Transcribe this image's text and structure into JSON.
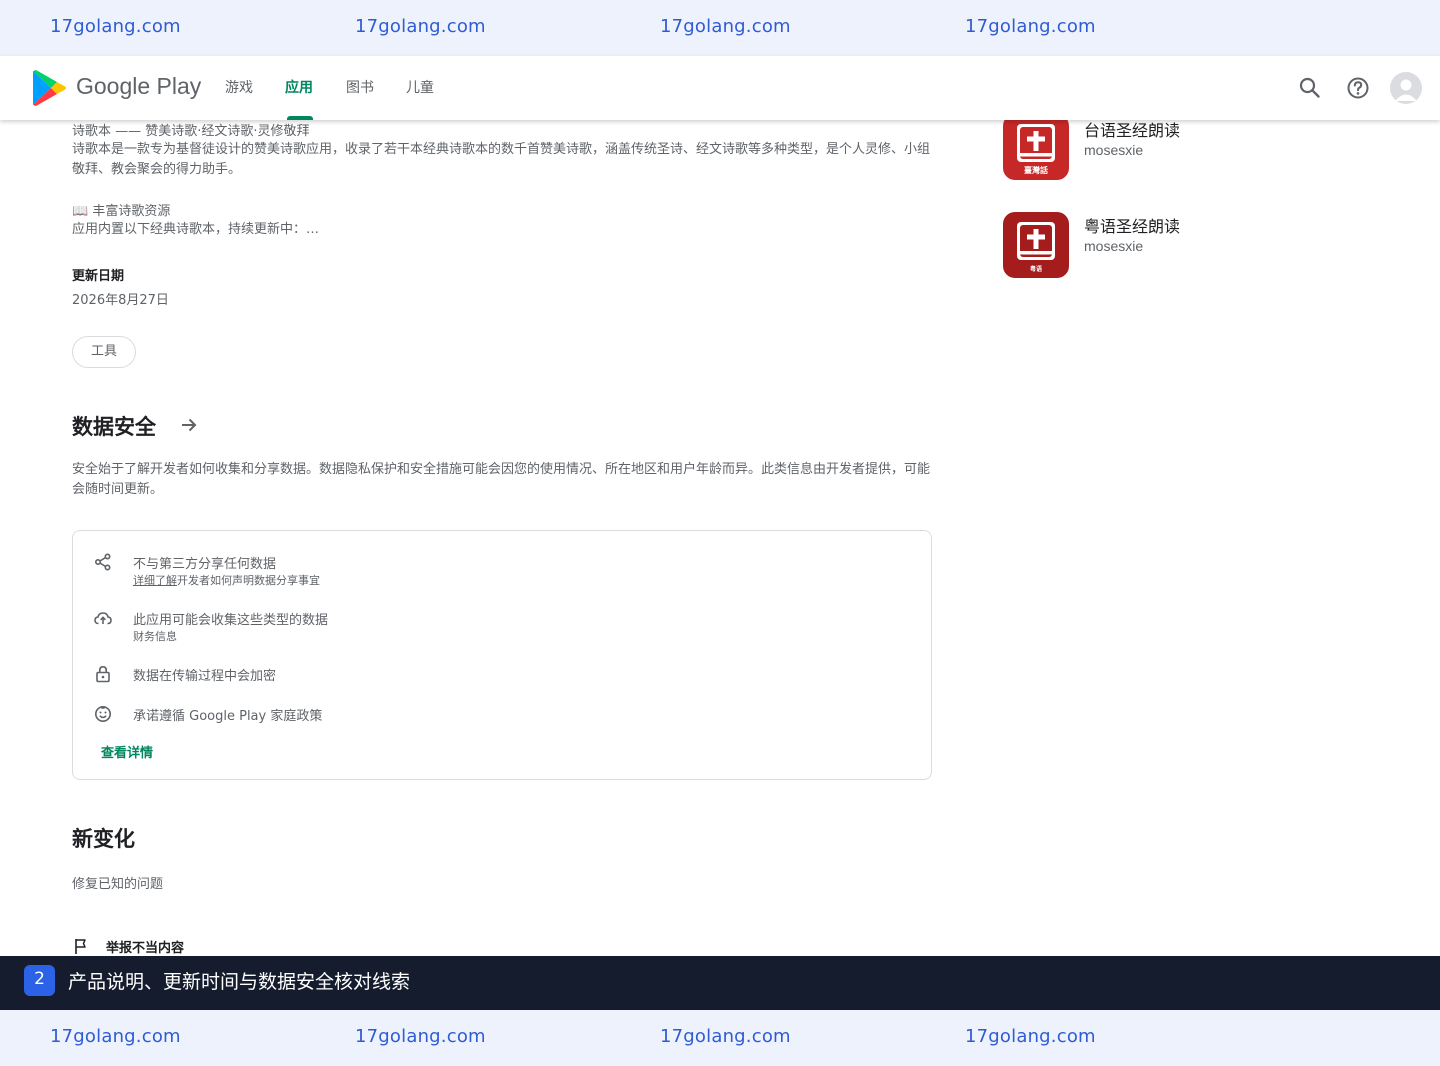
{
  "watermark": {
    "top": [
      "17golang.com",
      "17golang.com",
      "17golang.com",
      "17golang.com"
    ],
    "bottom": [
      "17golang.com",
      "17golang.com",
      "17golang.com",
      "17golang.com"
    ]
  },
  "header": {
    "brand": "Google Play",
    "nav": [
      "游戏",
      "应用",
      "图书",
      "儿童"
    ],
    "active_nav": "应用",
    "icons": [
      "search-icon",
      "help-icon",
      "account-icon"
    ]
  },
  "about": {
    "title_line": "诗歌本 —— 赞美诗歌·经文诗歌·灵修敬拜",
    "body": "诗歌本是一款专为基督徒设计的赞美诗歌应用，收录了若干本经典诗歌本的数千首赞美诗歌，涵盖传统圣诗、经文诗歌等多种类型，是个人灵修、小组敬拜、教会聚会的得力助手。",
    "resource_title": "📖 丰富诗歌资源",
    "resource_body": "应用内置以下经典诗歌本，持续更新中：…",
    "updated_label": "更新日期",
    "updated_value": "2026年8月27日",
    "category_chip": "工具"
  },
  "data_safety": {
    "title": "数据安全",
    "description": "安全始于了解开发者如何收集和分享数据。数据隐私保护和安全措施可能会因您的使用情况、所在地区和用户年龄而异。此类信息由开发者提供，可能会随时间更新。",
    "items": [
      {
        "icon": "share-icon",
        "main": "不与第三方分享任何数据",
        "link": "详细了解",
        "sub": "开发者如何声明数据分享事宜"
      },
      {
        "icon": "cloud-upload-icon",
        "main": "此应用可能会收集这些类型的数据",
        "sub": "财务信息"
      },
      {
        "icon": "lock-icon",
        "main": "数据在传输过程中会加密"
      },
      {
        "icon": "family-icon",
        "main": "承诺遵循 Google Play 家庭政策"
      }
    ],
    "more": "查看详情"
  },
  "whats_new": {
    "title": "新变化",
    "body": "修复已知的问题"
  },
  "report": {
    "icon": "flag-icon",
    "label": "举报不当内容"
  },
  "similar_apps": [
    {
      "name": "台语圣经朗读",
      "developer": "mosesxie",
      "icon_text": "臺灣話",
      "color": "#c62828"
    },
    {
      "name": "粤语圣经朗读",
      "developer": "mosesxie",
      "icon_text": "粤语",
      "color": "#a51c1c"
    }
  ],
  "caption": {
    "step": "2",
    "text": "产品说明、更新时间与数据安全核对线索"
  },
  "colors": {
    "accent": "#01875f",
    "watermark": "#2f5bd3",
    "caption_bg": "#141c2e",
    "badge": "#2b62e6"
  }
}
